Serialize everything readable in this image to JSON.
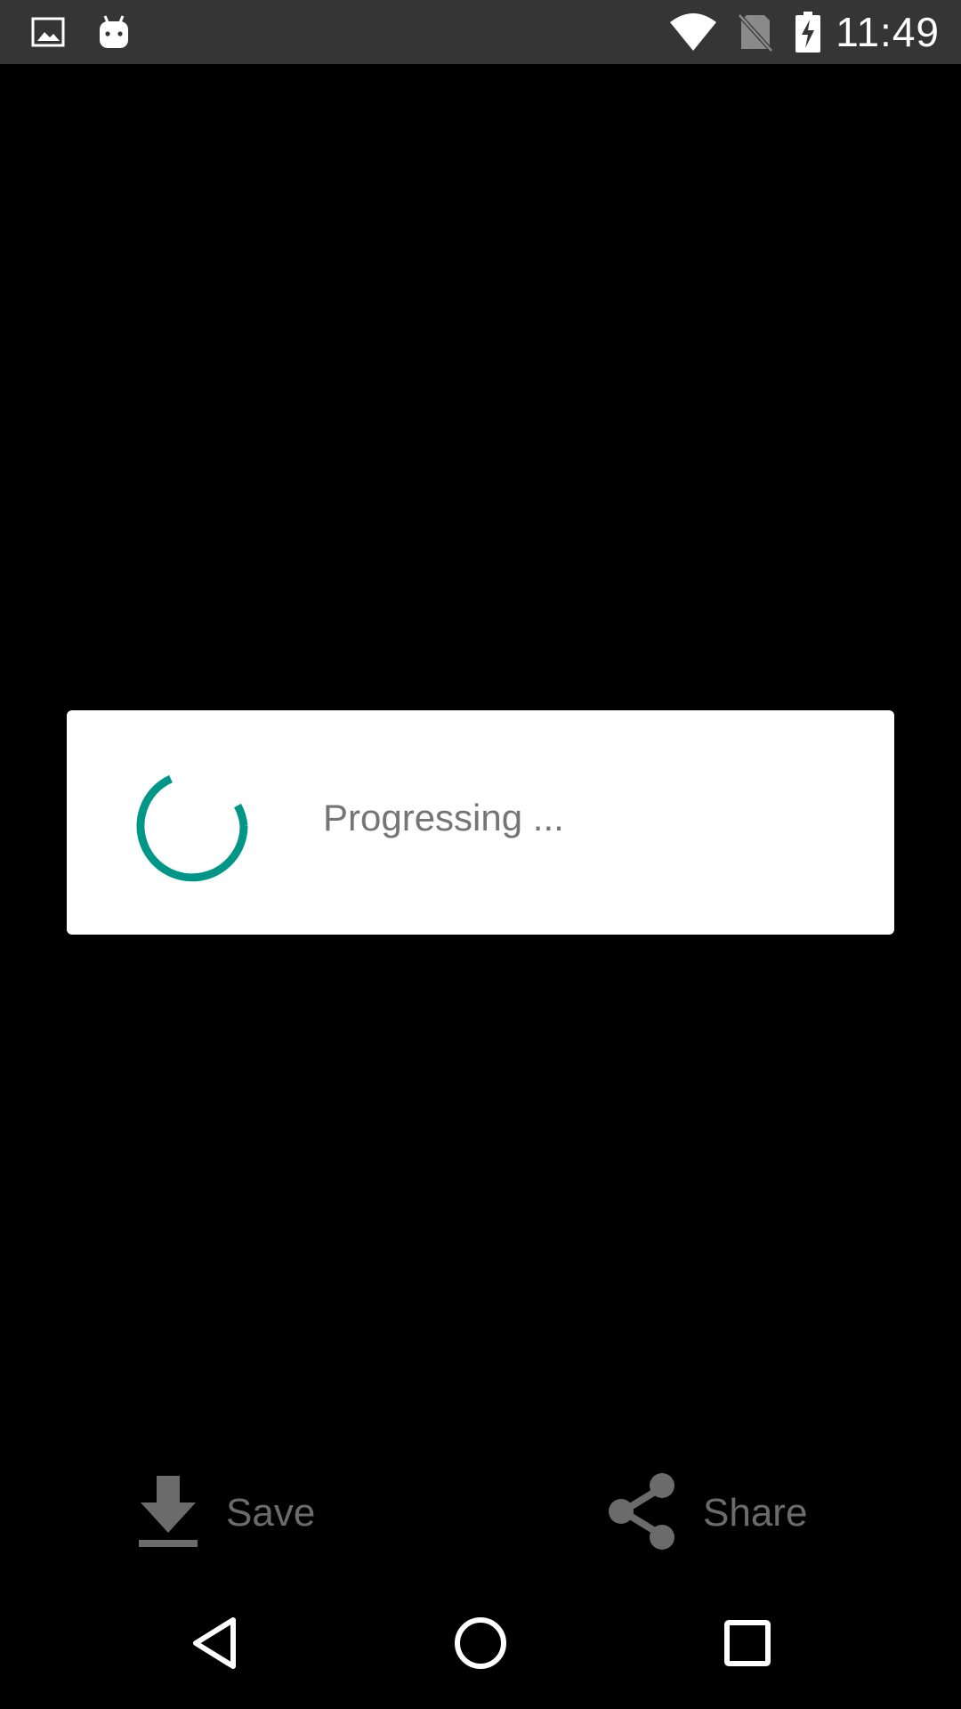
{
  "status_bar": {
    "time": "11:49",
    "left_icons": [
      "image-icon",
      "android-icon"
    ],
    "right_icons": [
      "wifi-icon",
      "no-sim-icon",
      "battery-charging-icon"
    ]
  },
  "dialog": {
    "message": "Progressing ...",
    "spinner_icon": "progress-spinner-icon",
    "accent_color": "#009688"
  },
  "actions": {
    "save": {
      "label": "Save",
      "icon": "download-icon"
    },
    "share": {
      "label": "Share",
      "icon": "share-icon"
    }
  },
  "nav_bar": {
    "back_icon": "back-triangle-icon",
    "home_icon": "home-circle-icon",
    "recents_icon": "recents-square-icon"
  },
  "colors": {
    "background": "#000000",
    "status_bar": "#353535",
    "dialog_bg": "#ffffff",
    "text_muted": "#757575",
    "action_gray": "#6b6b6b"
  }
}
